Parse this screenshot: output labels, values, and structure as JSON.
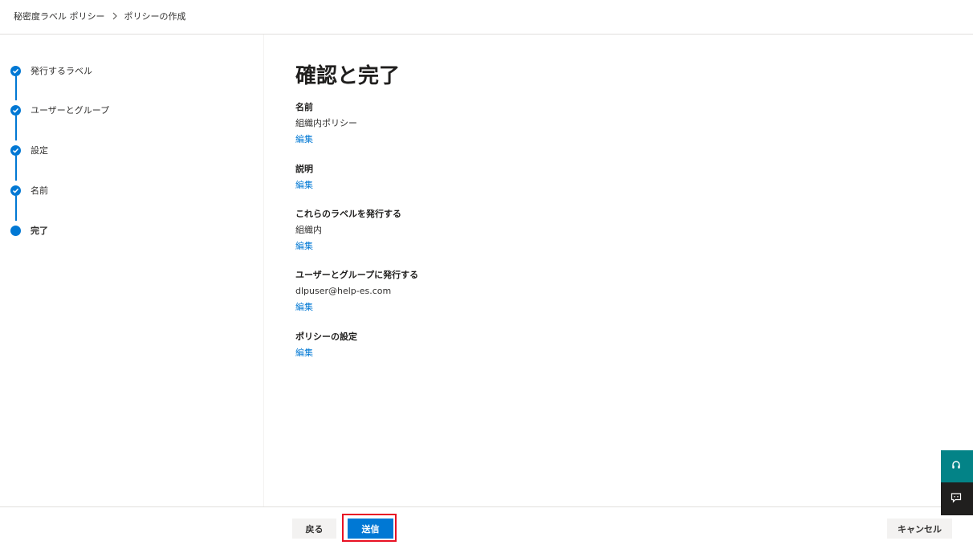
{
  "breadcrumb": {
    "parent": "秘密度ラベル ポリシー",
    "current": "ポリシーの作成"
  },
  "steps": [
    {
      "label": "発行するラベル",
      "state": "completed"
    },
    {
      "label": "ユーザーとグループ",
      "state": "completed"
    },
    {
      "label": "設定",
      "state": "completed"
    },
    {
      "label": "名前",
      "state": "completed"
    },
    {
      "label": "完了",
      "state": "current"
    }
  ],
  "main": {
    "title": "確認と完了",
    "sections": [
      {
        "heading": "名前",
        "value": "組織内ポリシー",
        "edit": "編集"
      },
      {
        "heading": "説明",
        "value": "",
        "edit": "編集"
      },
      {
        "heading": "これらのラベルを発行する",
        "value": "組織内",
        "edit": "編集"
      },
      {
        "heading": "ユーザーとグループに発行する",
        "value": "dlpuser@help-es.com",
        "edit": "編集"
      },
      {
        "heading": "ポリシーの設定",
        "value": "",
        "edit": "編集"
      }
    ]
  },
  "footer": {
    "back": "戻る",
    "submit": "送信",
    "cancel": "キャンセル"
  },
  "icons": {
    "step_completed": "checkmark-icon",
    "breadcrumb_separator": "chevron-right-icon",
    "help": "headset-icon",
    "feedback": "chat-icon"
  },
  "colors": {
    "accent": "#0078d4",
    "help_bg": "#038387",
    "feedback_bg": "#201f1e",
    "highlight": "#e81123"
  }
}
